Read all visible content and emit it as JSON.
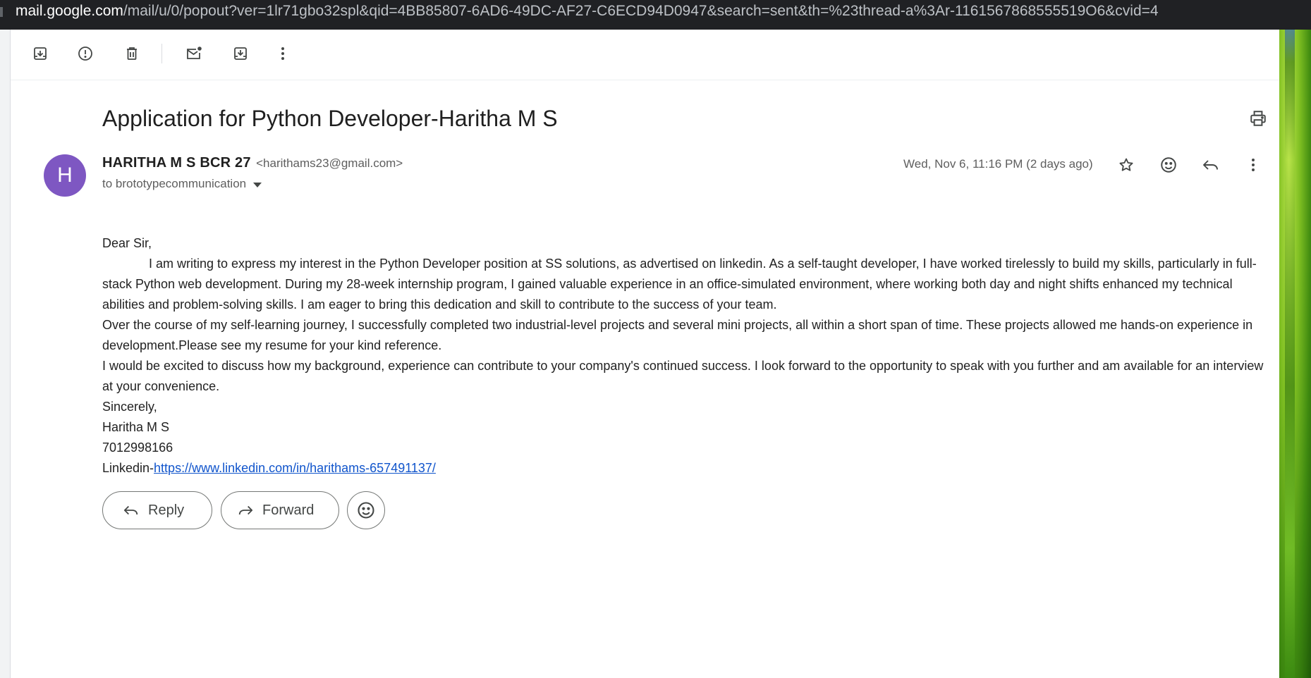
{
  "browser": {
    "url_host": "mail.google.com",
    "url_path": "/mail/u/0/popout?ver=1lr71gbo32spl&qid=4BB85807-6AD6-49DC-AF27-C6ECD94D0947&search=sent&th=%23thread-a%3Ar-1161567868555519O6&cvid=4"
  },
  "toolbar": {
    "icons": [
      "archive-icon",
      "report-spam-icon",
      "delete-icon",
      "mark-unread-icon",
      "move-to-icon",
      "more-vert-icon"
    ]
  },
  "email": {
    "subject": "Application for Python Developer-Haritha M S",
    "sender_initial": "H",
    "sender_name": "HARITHA M S BCR 27",
    "sender_email": "<harithams23@gmail.com>",
    "to_line": "to brototypecommunication",
    "date": "Wed, Nov 6, 11:16 PM (2 days ago)",
    "body": {
      "greeting": " Dear Sir,",
      "para1": "I am writing to express my interest in the Python Developer position at SS solutions, as advertised on linkedin. As a self-taught developer, I have worked tirelessly to build my skills, particularly in full-stack Python web development. During my 28-week internship program, I gained valuable experience in an office-simulated environment, where working both day and night shifts enhanced my technical abilities and problem-solving skills. I am eager to bring this dedication and skill to contribute to the success of your team.",
      "para2": "Over the course of my self-learning journey, I successfully completed two industrial-level projects and several mini projects, all within a short span of time. These projects allowed me  hands-on experience in development.Please see my resume  for your kind reference.",
      "para3": " I would be excited  to discuss how my background, experience can contribute to your company's continued success. I look forward to the opportunity to speak with you further and am available for an interview at your convenience.",
      "closing": "Sincerely,",
      "name": "Haritha M S",
      "phone": "7012998166",
      "linkedin_prefix": "Linkedin-",
      "linkedin_url": "https://www.linkedin.com/in/harithams-657491137/"
    }
  },
  "actions": {
    "reply_label": "Reply",
    "forward_label": "Forward"
  },
  "colors": {
    "avatar": "#7e57c2",
    "link": "#1155cc",
    "urlbar": "#202124"
  }
}
